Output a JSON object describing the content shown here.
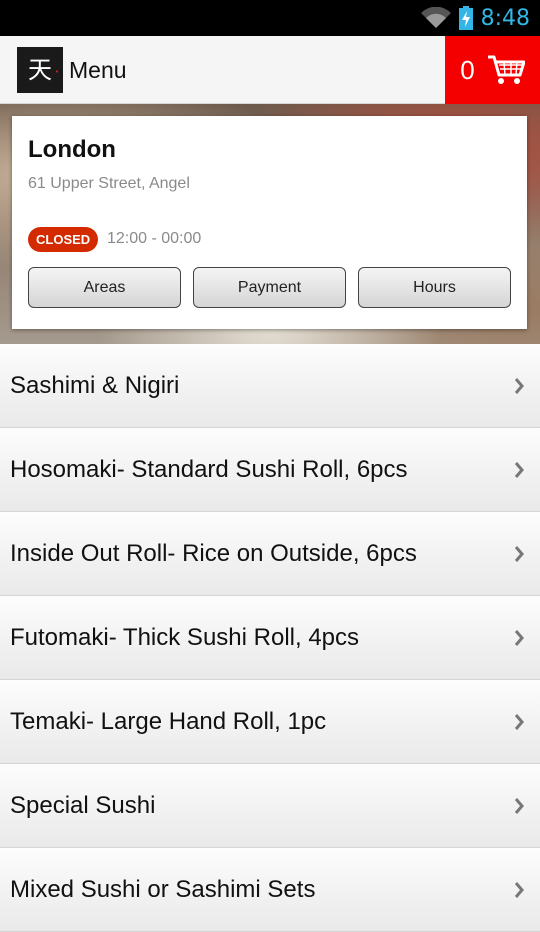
{
  "status": {
    "time": "8:48"
  },
  "header": {
    "title": "Menu",
    "cart_count": "0"
  },
  "colors": {
    "accent": "#f50000",
    "closed_badge": "#d42a00",
    "clock": "#33b5e5"
  },
  "restaurant": {
    "city": "London",
    "address": "61 Upper Street, Angel",
    "status": "CLOSED",
    "hours": "12:00 - 00:00",
    "buttons": [
      "Areas",
      "Payment",
      "Hours"
    ]
  },
  "menu": {
    "categories": [
      "Sashimi & Nigiri",
      "Hosomaki- Standard Sushi Roll, 6pcs",
      "Inside Out Roll- Rice on Outside, 6pcs",
      "Futomaki- Thick Sushi Roll, 4pcs",
      "Temaki- Large Hand Roll, 1pc",
      "Special Sushi",
      "Mixed Sushi or Sashimi Sets"
    ]
  },
  "icons": [
    "wifi-icon",
    "battery-icon",
    "logo",
    "cart-icon",
    "chevron-right-icon"
  ]
}
